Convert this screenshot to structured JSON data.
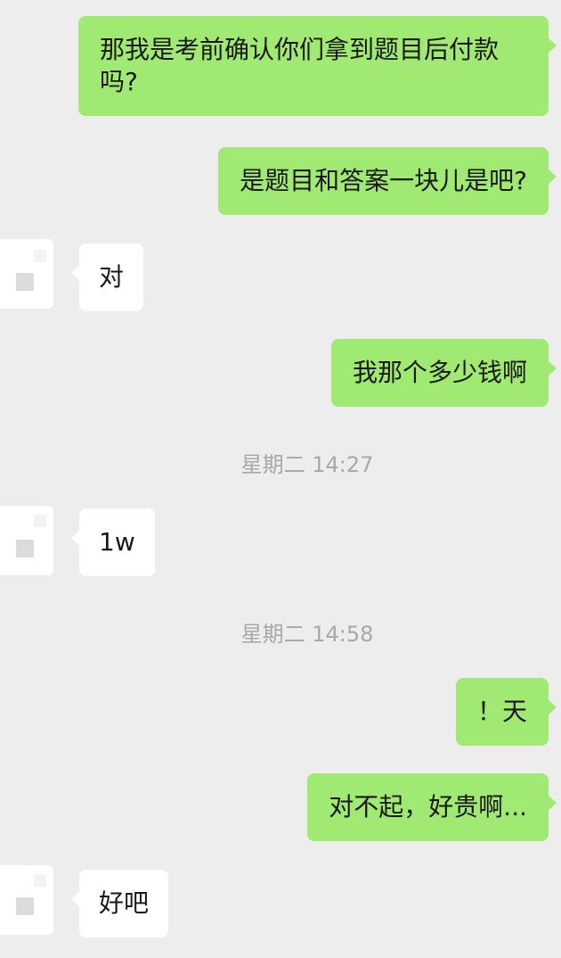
{
  "messages": [
    {
      "id": "m1",
      "dir": "out",
      "text": "那我是考前确认你们拿到题目后付款吗?"
    },
    {
      "id": "m2",
      "dir": "out",
      "text": "是题目和答案一块儿是吧?"
    },
    {
      "id": "m3",
      "dir": "in",
      "text": "对"
    },
    {
      "id": "m4",
      "dir": "out",
      "text": "我那个多少钱啊"
    },
    {
      "id": "t1",
      "dir": "time",
      "text": "星期二 14:27"
    },
    {
      "id": "m5",
      "dir": "in",
      "text": "1w"
    },
    {
      "id": "t2",
      "dir": "time",
      "text": "星期二 14:58"
    },
    {
      "id": "m6",
      "dir": "out",
      "text": "！天"
    },
    {
      "id": "m7",
      "dir": "out",
      "text": "对不起，好贵啊..."
    },
    {
      "id": "m8",
      "dir": "in",
      "text": "好吧"
    }
  ],
  "colors": {
    "background": "#ededed",
    "outgoing_bubble": "#a0e972",
    "incoming_bubble": "#ffffff",
    "timestamp_text": "#a8a8a8"
  }
}
